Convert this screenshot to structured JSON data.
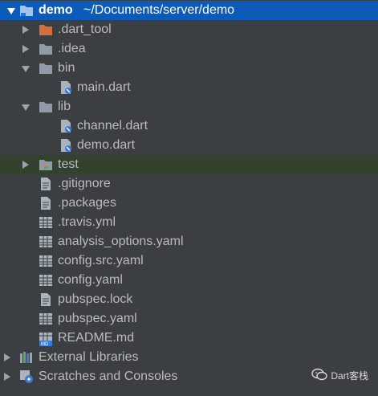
{
  "project_tree": {
    "root": {
      "name": "demo",
      "path": "~/Documents/server/demo",
      "icon": "module-folder-icon"
    },
    "items": [
      {
        "label": ".dart_tool",
        "icon": "excluded-folder-icon",
        "expanded": false
      },
      {
        "label": ".idea",
        "icon": "folder-icon",
        "expanded": false
      },
      {
        "label": "bin",
        "icon": "folder-icon",
        "expanded": true
      },
      {
        "label": "main.dart",
        "icon": "dart-file-icon"
      },
      {
        "label": "lib",
        "icon": "folder-icon",
        "expanded": true
      },
      {
        "label": "channel.dart",
        "icon": "dart-file-icon"
      },
      {
        "label": "demo.dart",
        "icon": "dart-file-icon"
      },
      {
        "label": "test",
        "icon": "test-folder-icon",
        "expanded": false
      },
      {
        "label": ".gitignore",
        "icon": "text-file-icon"
      },
      {
        "label": ".packages",
        "icon": "text-file-icon"
      },
      {
        "label": ".travis.yml",
        "icon": "yaml-file-icon"
      },
      {
        "label": "analysis_options.yaml",
        "icon": "yaml-file-icon"
      },
      {
        "label": "config.src.yaml",
        "icon": "yaml-file-icon"
      },
      {
        "label": "config.yaml",
        "icon": "yaml-file-icon"
      },
      {
        "label": "pubspec.lock",
        "icon": "text-file-icon"
      },
      {
        "label": "pubspec.yaml",
        "icon": "yaml-file-icon"
      },
      {
        "label": "README.md",
        "icon": "markdown-file-icon"
      }
    ],
    "external_libraries": "External Libraries",
    "scratches": "Scratches and Consoles"
  },
  "watermark": {
    "text": "Dart客栈",
    "icon": "wechat-icon"
  },
  "colors": {
    "background": "#3c3f41",
    "selection": "#0d5bb8",
    "test_highlight": "#32422f",
    "folder": "#8f9ba7",
    "excluded_folder": "#d46e3b"
  }
}
